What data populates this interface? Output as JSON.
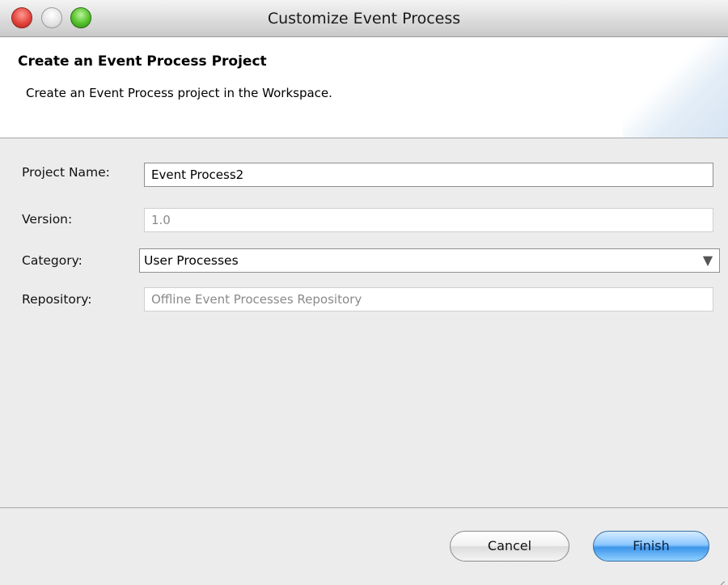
{
  "window": {
    "title": "Customize Event Process"
  },
  "banner": {
    "title": "Create an Event Process Project",
    "description": "Create an Event Process project in the Workspace."
  },
  "form": {
    "project_name": {
      "label": "Project Name:",
      "value": "Event Process2"
    },
    "version": {
      "label": "Version:",
      "value": "1.0"
    },
    "category": {
      "label": "Category:",
      "value": "User Processes"
    },
    "repository": {
      "label": "Repository:",
      "value": "Offline Event Processes Repository"
    }
  },
  "buttons": {
    "cancel": "Cancel",
    "finish": "Finish"
  },
  "icons": {
    "close": "close-icon",
    "minimize": "minimize-icon",
    "zoom": "zoom-icon",
    "dropdown": "chevron-down-icon",
    "resize": "resize-grip-icon"
  },
  "colors": {
    "accent": "#3d95ea",
    "close": "#e2443b",
    "zoom": "#54c02a"
  }
}
